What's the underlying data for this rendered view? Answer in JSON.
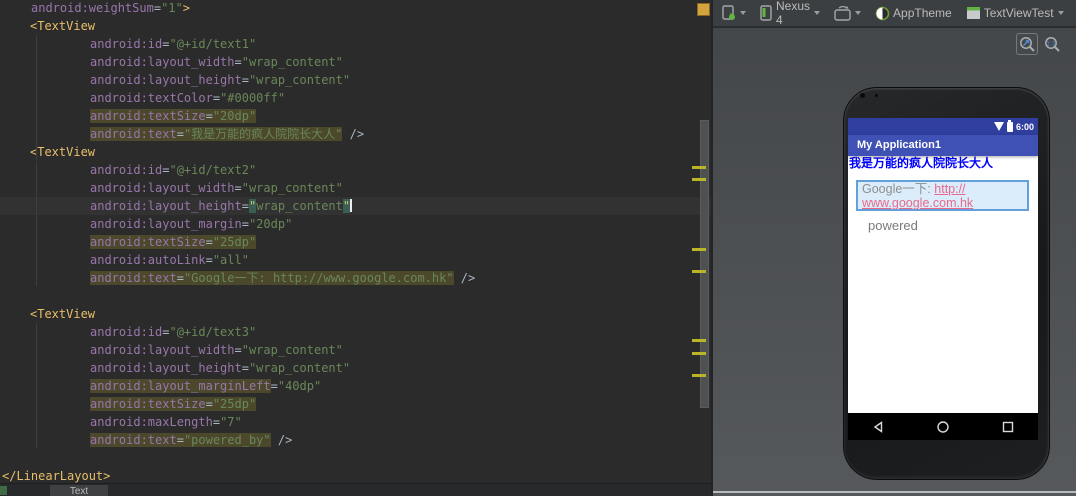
{
  "editor": {
    "bottom_tab": "Text",
    "lines": [
      {
        "ind": 31,
        "tk": [
          {
            "t": "android:weightSum",
            "c": "a"
          },
          {
            "t": "=",
            "c": "p"
          },
          {
            "t": "\"1\"",
            "c": "v"
          },
          {
            "t": ">",
            "c": "g"
          }
        ]
      },
      {
        "ind": 30,
        "tk": [
          {
            "t": "<TextView",
            "c": "g"
          }
        ]
      },
      {
        "ind": 90,
        "tk": [
          {
            "t": "android:id",
            "c": "a"
          },
          {
            "t": "=",
            "c": "p"
          },
          {
            "t": "\"@+id/text1\"",
            "c": "v"
          }
        ]
      },
      {
        "ind": 90,
        "tk": [
          {
            "t": "android:layout_width",
            "c": "a"
          },
          {
            "t": "=",
            "c": "p"
          },
          {
            "t": "\"wrap_content\"",
            "c": "v"
          }
        ]
      },
      {
        "ind": 90,
        "tk": [
          {
            "t": "android:layout_height",
            "c": "a"
          },
          {
            "t": "=",
            "c": "p"
          },
          {
            "t": "\"wrap_content\"",
            "c": "v"
          }
        ]
      },
      {
        "ind": 90,
        "tk": [
          {
            "t": "android:textColor",
            "c": "a"
          },
          {
            "t": "=",
            "c": "p"
          },
          {
            "t": "\"#0000ff\"",
            "c": "v"
          }
        ]
      },
      {
        "ind": 90,
        "tk": [
          {
            "t": "android:textSize",
            "c": "a",
            "h": 1
          },
          {
            "t": "=",
            "c": "p",
            "h": 1
          },
          {
            "t": "\"20dp\"",
            "c": "v",
            "h": 1
          }
        ]
      },
      {
        "ind": 90,
        "tk": [
          {
            "t": "android:text",
            "c": "a",
            "h": 1
          },
          {
            "t": "=",
            "c": "p",
            "h": 1
          },
          {
            "t": "\"我是万能的疯人院院长大人\"",
            "c": "v",
            "h": 1
          },
          {
            "t": " />",
            "c": "p"
          }
        ]
      },
      {
        "ind": 30,
        "tk": [
          {
            "t": "<TextView",
            "c": "g"
          }
        ]
      },
      {
        "ind": 90,
        "tk": [
          {
            "t": "android:id",
            "c": "a"
          },
          {
            "t": "=",
            "c": "p"
          },
          {
            "t": "\"@+id/text2\"",
            "c": "v"
          }
        ]
      },
      {
        "ind": 90,
        "tk": [
          {
            "t": "android:layout_width",
            "c": "a"
          },
          {
            "t": "=",
            "c": "p"
          },
          {
            "t": "\"wrap_content\"",
            "c": "v"
          }
        ]
      },
      {
        "ind": 90,
        "cur": 1,
        "caret": 1,
        "tk": [
          {
            "t": "android:layout_height",
            "c": "a"
          },
          {
            "t": "=",
            "c": "p"
          },
          {
            "t": "\"",
            "c": "q"
          },
          {
            "t": "wrap_content",
            "c": "v"
          },
          {
            "t": "\"",
            "c": "q"
          }
        ]
      },
      {
        "ind": 90,
        "tk": [
          {
            "t": "android:layout_margin",
            "c": "a"
          },
          {
            "t": "=",
            "c": "p"
          },
          {
            "t": "\"20dp\"",
            "c": "v"
          }
        ]
      },
      {
        "ind": 90,
        "tk": [
          {
            "t": "android:textSize",
            "c": "a",
            "h": 1
          },
          {
            "t": "=",
            "c": "p",
            "h": 1
          },
          {
            "t": "\"25dp\"",
            "c": "v",
            "h": 1
          }
        ]
      },
      {
        "ind": 90,
        "tk": [
          {
            "t": "android:autoLink",
            "c": "a"
          },
          {
            "t": "=",
            "c": "p"
          },
          {
            "t": "\"all\"",
            "c": "v"
          }
        ]
      },
      {
        "ind": 90,
        "tk": [
          {
            "t": "android:text",
            "c": "a",
            "h": 1
          },
          {
            "t": "=",
            "c": "p",
            "h": 1
          },
          {
            "t": "\"Google一下: http://www.google.com.hk\"",
            "c": "v",
            "h": 1
          },
          {
            "t": " />",
            "c": "p"
          }
        ]
      },
      {
        "ind": 90,
        "tk": []
      },
      {
        "ind": 30,
        "tk": [
          {
            "t": "<TextView",
            "c": "g"
          }
        ]
      },
      {
        "ind": 90,
        "tk": [
          {
            "t": "android:id",
            "c": "a"
          },
          {
            "t": "=",
            "c": "p"
          },
          {
            "t": "\"@+id/text3\"",
            "c": "v"
          }
        ]
      },
      {
        "ind": 90,
        "tk": [
          {
            "t": "android:layout_width",
            "c": "a"
          },
          {
            "t": "=",
            "c": "p"
          },
          {
            "t": "\"wrap_content\"",
            "c": "v"
          }
        ]
      },
      {
        "ind": 90,
        "tk": [
          {
            "t": "android:layout_height",
            "c": "a"
          },
          {
            "t": "=",
            "c": "p"
          },
          {
            "t": "\"wrap_content\"",
            "c": "v"
          }
        ]
      },
      {
        "ind": 90,
        "tk": [
          {
            "t": "android:layout_marginLeft",
            "c": "a",
            "h": 1
          },
          {
            "t": "=",
            "c": "p"
          },
          {
            "t": "\"40dp\"",
            "c": "v"
          }
        ]
      },
      {
        "ind": 90,
        "tk": [
          {
            "t": "android:textSize",
            "c": "a",
            "h": 1
          },
          {
            "t": "=",
            "c": "p",
            "h": 1
          },
          {
            "t": "\"25dp\"",
            "c": "v",
            "h": 1
          }
        ]
      },
      {
        "ind": 90,
        "tk": [
          {
            "t": "android:maxLength",
            "c": "a"
          },
          {
            "t": "=",
            "c": "p"
          },
          {
            "t": "\"7\"",
            "c": "v"
          }
        ]
      },
      {
        "ind": 90,
        "tk": [
          {
            "t": "android:text",
            "c": "a",
            "h": 1
          },
          {
            "t": "=",
            "c": "p",
            "h": 1
          },
          {
            "t": "\"powered_by\"",
            "c": "v",
            "h": 1
          },
          {
            "t": " />",
            "c": "p"
          }
        ]
      },
      {
        "ind": 90,
        "tk": []
      },
      {
        "ind": 2,
        "tk": [
          {
            "t": "</LinearLayout>",
            "c": "g"
          }
        ]
      }
    ]
  },
  "preview": {
    "toolbar": {
      "device_label": "Nexus 4",
      "theme_label": "AppTheme",
      "activity_label": "TextViewTest"
    },
    "phone": {
      "status_time": "6:00",
      "app_title": "My Application1",
      "text1": "我是万能的疯人院院长大人",
      "text2_gray": "Google一下: ",
      "text2_link_line1": "http://",
      "text2_link_line2": "www.google.com.hk",
      "text3": "powered"
    },
    "colors": {
      "status_bar": "#303F9F",
      "app_bar": "#3F51B5",
      "text1_color": "#0000ff",
      "link_color": "#E9698C",
      "text3_color": "#7A7A7A",
      "selection_border": "#63A1DC",
      "selection_bg": "#DBEDFB"
    }
  }
}
